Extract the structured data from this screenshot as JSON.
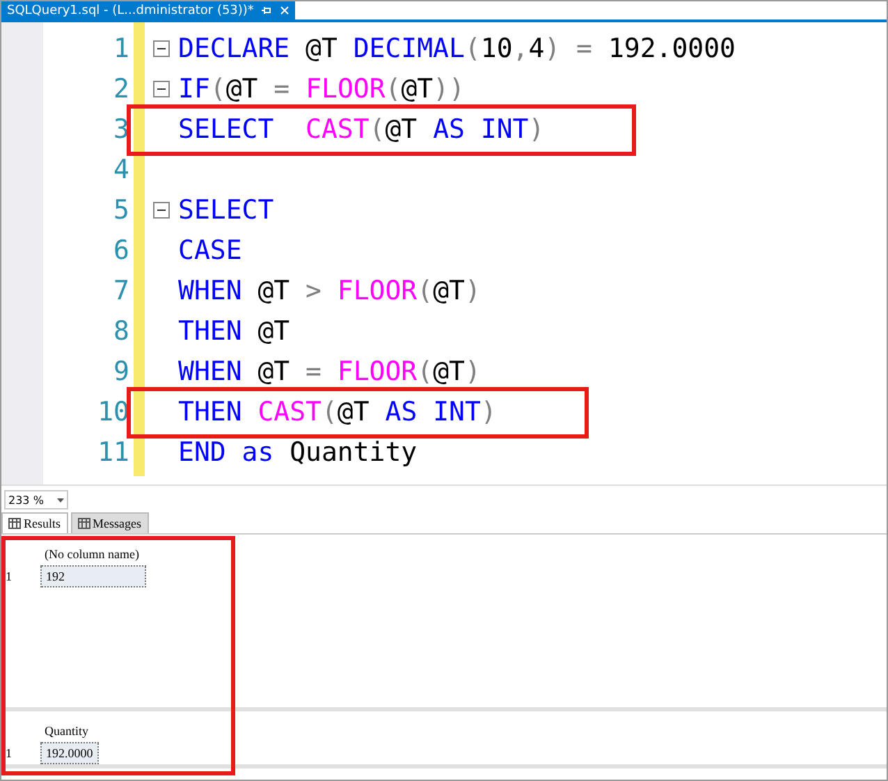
{
  "document_tab": {
    "title": "SQLQuery1.sql - (L...dministrator (53))*"
  },
  "editor": {
    "lines": [
      {
        "number": "1",
        "fold": true,
        "highlighted": false,
        "tokens": [
          {
            "kind": "kw",
            "text": "DECLARE "
          },
          {
            "kind": "id",
            "text": "@T "
          },
          {
            "kind": "kw",
            "text": "DECIMAL"
          },
          {
            "kind": "op",
            "text": "("
          },
          {
            "kind": "id",
            "text": "10"
          },
          {
            "kind": "op",
            "text": ","
          },
          {
            "kind": "id",
            "text": "4"
          },
          {
            "kind": "op",
            "text": ") = "
          },
          {
            "kind": "id",
            "text": "192.0000"
          }
        ]
      },
      {
        "number": "2",
        "fold": true,
        "highlighted": false,
        "tokens": [
          {
            "kind": "kw",
            "text": "IF"
          },
          {
            "kind": "op",
            "text": "("
          },
          {
            "kind": "id",
            "text": "@T"
          },
          {
            "kind": "op",
            "text": " = "
          },
          {
            "kind": "fn",
            "text": "FLOOR"
          },
          {
            "kind": "op",
            "text": "("
          },
          {
            "kind": "id",
            "text": "@T"
          },
          {
            "kind": "op",
            "text": "))"
          }
        ]
      },
      {
        "number": "3",
        "fold": false,
        "highlighted": true,
        "tokens": [
          {
            "kind": "kw",
            "text": "SELECT  "
          },
          {
            "kind": "fn",
            "text": "CAST"
          },
          {
            "kind": "op",
            "text": "("
          },
          {
            "kind": "id",
            "text": "@T "
          },
          {
            "kind": "kw",
            "text": "AS INT"
          },
          {
            "kind": "op",
            "text": ")"
          }
        ]
      },
      {
        "number": "4",
        "fold": false,
        "highlighted": false
      },
      {
        "number": "5",
        "fold": true,
        "highlighted": false,
        "tokens": [
          {
            "kind": "kw",
            "text": "SELECT"
          }
        ]
      },
      {
        "number": "6",
        "fold": false,
        "highlighted": false,
        "tokens": [
          {
            "kind": "kw",
            "text": "CASE"
          }
        ]
      },
      {
        "number": "7",
        "fold": false,
        "highlighted": false,
        "tokens": [
          {
            "kind": "kw",
            "text": "WHEN "
          },
          {
            "kind": "id",
            "text": "@T "
          },
          {
            "kind": "op",
            "text": "> "
          },
          {
            "kind": "fn",
            "text": "FLOOR"
          },
          {
            "kind": "op",
            "text": "("
          },
          {
            "kind": "id",
            "text": "@T"
          },
          {
            "kind": "op",
            "text": ")"
          }
        ]
      },
      {
        "number": "8",
        "fold": false,
        "highlighted": false,
        "tokens": [
          {
            "kind": "kw",
            "text": "THEN "
          },
          {
            "kind": "id",
            "text": "@T"
          }
        ]
      },
      {
        "number": "9",
        "fold": false,
        "highlighted": false,
        "tokens": [
          {
            "kind": "kw",
            "text": "WHEN "
          },
          {
            "kind": "id",
            "text": "@T "
          },
          {
            "kind": "op",
            "text": "= "
          },
          {
            "kind": "fn",
            "text": "FLOOR"
          },
          {
            "kind": "op",
            "text": "("
          },
          {
            "kind": "id",
            "text": "@T"
          },
          {
            "kind": "op",
            "text": ")"
          }
        ]
      },
      {
        "number": "10",
        "fold": false,
        "highlighted": true,
        "tokens": [
          {
            "kind": "kw",
            "text": "THEN "
          },
          {
            "kind": "fn",
            "text": "CAST"
          },
          {
            "kind": "op",
            "text": "("
          },
          {
            "kind": "id",
            "text": "@T "
          },
          {
            "kind": "kw",
            "text": "AS INT"
          },
          {
            "kind": "op",
            "text": ")"
          }
        ]
      },
      {
        "number": "11",
        "fold": false,
        "highlighted": false,
        "tokens": [
          {
            "kind": "kw",
            "text": "END as "
          },
          {
            "kind": "id",
            "text": "Quantity"
          }
        ]
      }
    ]
  },
  "zoom": {
    "value": "233 %"
  },
  "result_tabs": [
    {
      "label": "Results",
      "selected": true
    },
    {
      "label": "Messages",
      "selected": false
    }
  ],
  "results": {
    "highlighted": true,
    "grids": [
      {
        "column": "(No column name)",
        "rows": [
          {
            "number": "1",
            "value": "192"
          }
        ]
      },
      {
        "column": "Quantity",
        "rows": [
          {
            "number": "1",
            "value": "192.0000"
          }
        ]
      }
    ]
  }
}
